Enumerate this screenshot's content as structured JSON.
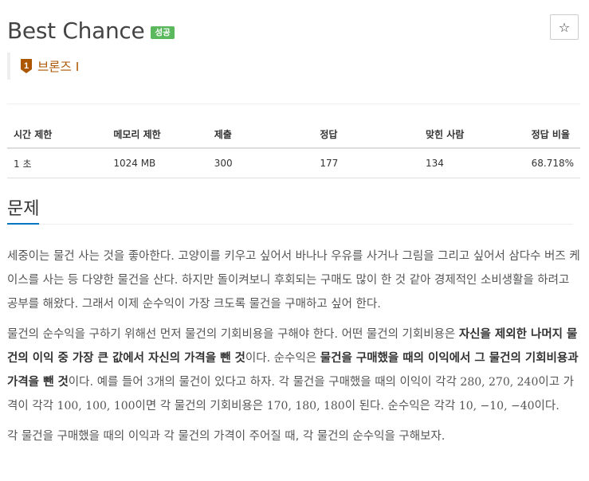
{
  "problem": {
    "title": "Best Chance",
    "status_badge": "성공",
    "star_icon": "☆",
    "tier": {
      "label": "브론즈 I",
      "icon_number": "1",
      "color": "#ad5600"
    }
  },
  "info_table": {
    "headers": [
      "시간 제한",
      "메모리 제한",
      "제출",
      "정답",
      "맞힌 사람",
      "정답 비율"
    ],
    "values": [
      "1 초",
      "1024 MB",
      "300",
      "177",
      "134",
      "68.718%"
    ]
  },
  "section": {
    "title": "문제"
  },
  "description": {
    "p1": "세중이는 물건 사는 것을 좋아한다. 고양이를 키우고 싶어서 바나나 우유를 사거나 그림을 그리고 싶어서 삼다수 버즈 케이스를 사는 등 다양한 물건을 산다. 하지만 돌이켜보니 후회되는 구매도 많이 한 것 같아 경제적인 소비생활을 하려고 공부를 해왔다. 그래서 이제 순수익이 가장 크도록 물건을 구매하고 싶어 한다.",
    "p2": {
      "t1": "물건의 순수익을 구하기 위해선 먼저 물건의 기회비용을 구해야 한다. 어떤 물건의 기회비용은 ",
      "b1": "자신을 제외한 나머지 물건의 이익 중 가장 큰 값에서 자신의 가격을 뺀 것",
      "t2": "이다. 순수익은 ",
      "b2": "물건을 구매했을 때의 이익에서 그 물건의 기회비용과 가격을 뺀 것",
      "t3": "이다. 예를 들어 ",
      "m1": "3",
      "t4": "개의 물건이 있다고 하자. 각 물건을 구매했을 때의 이익이 각각 ",
      "m2": "280, 270, 240",
      "t5": "이고 가격이 각각 ",
      "m3": "100, 100, 100",
      "t6": "이면 각 물건의 기회비용은 ",
      "m4": "170, 180, 180",
      "t7": "이 된다. 순수익은 각각 ",
      "m5": "10, −10, −40",
      "t8": "이다."
    },
    "p3": "각 물건을 구매했을 때의 이익과 각 물건의 가격이 주어질 때, 각 물건의 순수익을 구해보자."
  }
}
